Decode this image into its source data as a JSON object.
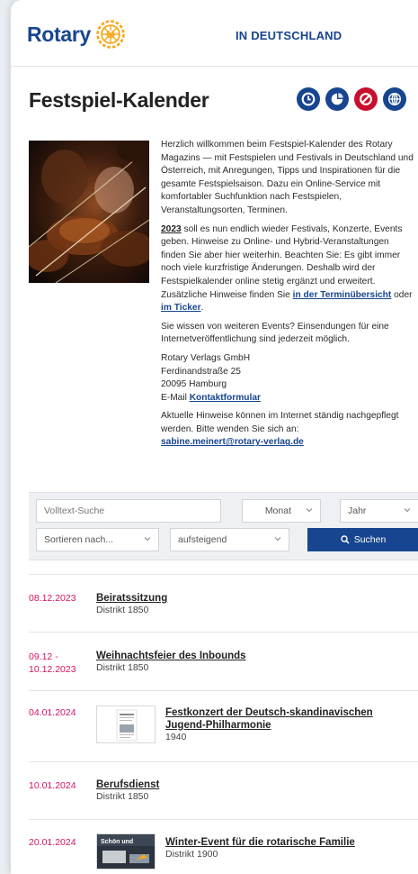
{
  "header": {
    "logo_text": "Rotary",
    "nav_title": "IN DEUTSCHLAND"
  },
  "title": "Festspiel-Kalender",
  "action_icons": [
    "clock-icon",
    "pie-chart-icon",
    "no-symbol-icon",
    "globe-icon"
  ],
  "colors": {
    "brand_blue": "#17458f",
    "gold": "#f7a81b",
    "date_pink": "#d41367",
    "red_icon": "#c8102e"
  },
  "intro": {
    "p1": "Herzlich willkommen beim Festspiel-Kalender des Rotary Magazins — mit Festspielen und Festivals in Deutschland und Österreich, mit Anregungen, Tipps und Inspirationen für die gesamte Festspielsaison. Dazu ein Online-Service mit komfortabler Suchfunktion nach Festspielen, Veranstaltungsorten, Terminen.",
    "p2_year": "2023",
    "p2_text": " soll es nun endlich wieder Festivals, Konzerte, Events geben. Hinweise zu Online- und Hybrid-Veranstaltungen finden Sie aber hier weiterhin. Beachten Sie: Es gibt immer noch viele kurzfristige Änderungen. Deshalb wird der Festspielkalender online stetig ergänzt und erweitert. Zusätzliche Hinweise finden Sie ",
    "p2_link1": "in der Terminübersicht",
    "p2_mid": " oder ",
    "p2_link2": "im Ticker",
    "p2_end": ".",
    "p3": "Sie wissen von weiteren Events? Einsendungen für eine Internetveröffentlichung sind jederzeit möglich.",
    "addr1": "Rotary Verlags GmbH",
    "addr2": "Ferdinandstraße 25",
    "addr3": "20095 Hamburg",
    "addr4_prefix": "E-Mail ",
    "addr4_link": "Kontaktformular",
    "p5": "Aktuelle Hinweise können im Internet ständig nachgepflegt werden. Bitte wenden Sie sich an:",
    "email": "sabine.meinert@rotary-verlag.de"
  },
  "search": {
    "fulltext_placeholder": "Volltext-Suche",
    "month": "Monat",
    "year": "Jahr",
    "sort": "Sortieren nach...",
    "order": "aufsteigend",
    "button": "Suchen"
  },
  "events": [
    {
      "date": "08.12.2023",
      "title": "Beiratssitzung",
      "sub": "Distrikt 1850"
    },
    {
      "date": "09.12 -",
      "date2": "10.12.2023",
      "title": "Weihnachtsfeier des Inbounds",
      "sub": "Distrikt 1850"
    },
    {
      "date": "04.01.2024",
      "title": "Festkonzert der Deutsch-skandinavischen Jugend-Philharmonie",
      "sub": "1940"
    },
    {
      "date": "10.01.2024",
      "title": "Berufsdienst",
      "sub": "Distrikt 1850"
    },
    {
      "date": "20.01.2024",
      "title": "Winter-Event für die rotarische Familie",
      "sub": "Distrikt 1900",
      "thumb_text": "Schön und"
    }
  ]
}
